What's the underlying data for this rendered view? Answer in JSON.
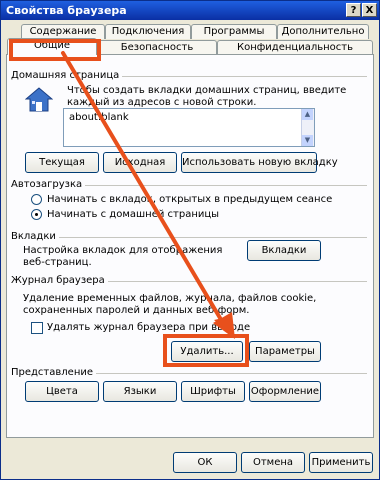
{
  "window": {
    "title": "Свойства браузера",
    "help_btn": "?",
    "close_btn": "X"
  },
  "tabs_row1": [
    {
      "label": "Содержание"
    },
    {
      "label": "Подключения"
    },
    {
      "label": "Программы"
    },
    {
      "label": "Дополнительно"
    }
  ],
  "tabs_row2": [
    {
      "label": "Общие"
    },
    {
      "label": "Безопасность"
    },
    {
      "label": "Конфиденциальность"
    }
  ],
  "home": {
    "section": "Домашняя страница",
    "description_1": "Чтобы создать вкладки домашних страниц, введите",
    "description_2": "каждый из адресов с новой строки.",
    "url_value": "about:blank",
    "btn_current": "Текущая",
    "btn_default": "Исходная",
    "btn_new_tab": "Использовать новую вкладку"
  },
  "startup": {
    "section": "Автозагрузка",
    "option_prev": "Начинать с вкладок, открытых в предыдущем сеансе",
    "option_home": "Начинать с домашней страницы"
  },
  "tabs_section": {
    "section": "Вкладки",
    "description_1": "Настройка вкладок для отображения",
    "description_2": "веб-страниц.",
    "btn": "Вкладки"
  },
  "history": {
    "section": "Журнал браузера",
    "description_1": "Удаление временных файлов, журнала, файлов cookie,",
    "description_2": "сохраненных паролей и данных веб-форм.",
    "checkbox_label": "Удалять журнал браузера при выходе",
    "btn_delete": "Удалить...",
    "btn_params": "Параметры"
  },
  "appearance": {
    "section": "Представление",
    "btn_colors": "Цвета",
    "btn_languages": "Языки",
    "btn_fonts": "Шрифты",
    "btn_design": "Оформление"
  },
  "footer": {
    "ok": "ОК",
    "cancel": "Отмена",
    "apply": "Применить"
  },
  "annotation": {
    "color": "#e8501c"
  }
}
